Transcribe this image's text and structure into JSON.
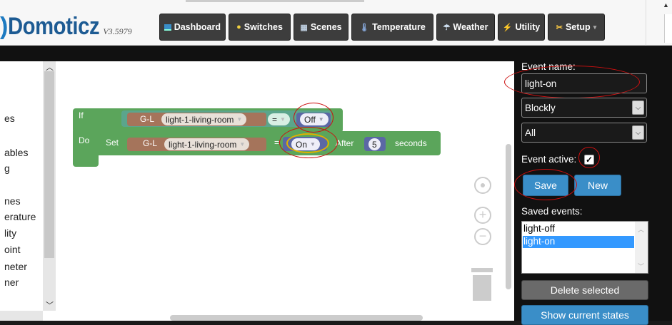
{
  "header": {
    "logo": {
      "paren": ")",
      "name": "Domoticz",
      "version": "V3.5979"
    },
    "nav": {
      "dashboard": "Dashboard",
      "switches": "Switches",
      "scenes": "Scenes",
      "temperature": "Temperature",
      "weather": "Weather",
      "utility": "Utility",
      "setup": "Setup"
    }
  },
  "left_menu": {
    "items": [
      "es",
      "ables",
      "g",
      "nes",
      "erature",
      "lity",
      "oint",
      "neter",
      "ner"
    ]
  },
  "blockly": {
    "if_label": "If",
    "do_label": "Do",
    "set_label": "Set",
    "if_device_group": "G-L",
    "if_device_name": "light-1-living-room",
    "if_operator": "=",
    "if_value": "Off",
    "do_device_group": "G-L",
    "do_device_name": "light-1-living-room",
    "do_operator": "=",
    "do_value": "On",
    "after_label": "After",
    "after_number": "5",
    "seconds_label": "seconds"
  },
  "event_panel": {
    "event_name_label": "Event name:",
    "event_name_value": "light-on",
    "interpreter_value": "Blockly",
    "trigger_value": "All",
    "event_active_label": "Event active:",
    "event_active_checked": true,
    "save_label": "Save",
    "new_label": "New",
    "saved_events_label": "Saved events:",
    "saved_events": [
      "light-off",
      "light-on"
    ],
    "selected_event": "light-on",
    "delete_label": "Delete selected",
    "show_states_label": "Show current states"
  },
  "colors": {
    "accent_blue": "#3a8ec8",
    "blockly_logic_green": "#5ba55b",
    "blockly_device_brown": "#a5745b",
    "annotation_red": "#cc1010"
  }
}
